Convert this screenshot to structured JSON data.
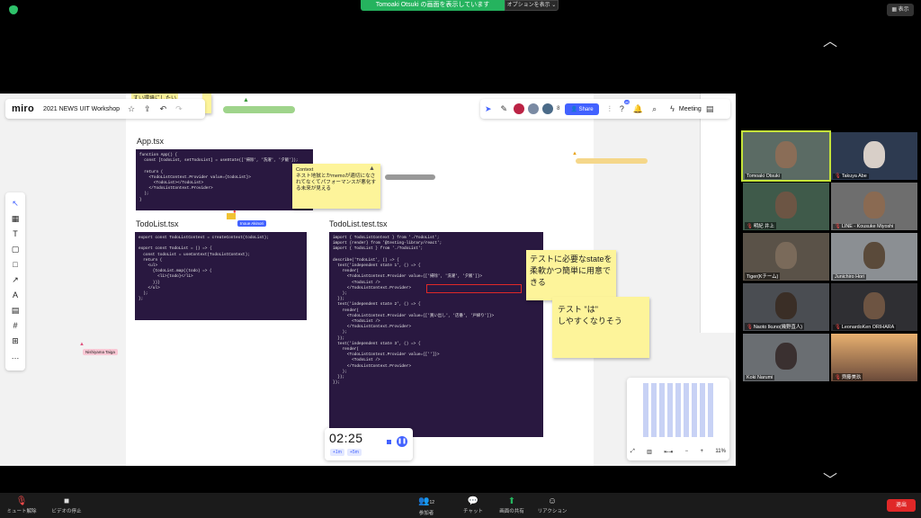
{
  "zoom_top": {
    "share_banner": "Tomoaki Otsuki の画面を表示しています",
    "options": "オプションを表示 ⌄",
    "view_button": "表示"
  },
  "miro": {
    "logo": "miro",
    "board_name": "2021 NEWS UIT Workshop",
    "avatar_count": "8",
    "share_label": "Share",
    "meeting_label": "Meeting",
    "notif_badge": "40",
    "top_sticky_text": "すい環境にしたい",
    "left_tools": [
      "↖",
      "▦",
      "T",
      "▢",
      "□",
      "↗",
      "A",
      "▤",
      "#",
      "⊞",
      "…"
    ],
    "frames": {
      "app_title": "App.tsx",
      "todolist_title": "TodoList.tsx",
      "test_title": "TodoList.test.tsx"
    },
    "code_app": "function App() {\n  const [todoList, setTodoList] = useState(['掃除', '洗濯', '夕飯']);\n\n  return (\n    <TodoListContext.Provider value={todoList}>\n      <TodoList></TodoList>\n    </TodoListContext.Provider>\n  );\n}",
    "code_todolist": "export const TodoListContext = createContext(todoList);\n\nexport const TodoList = () => {\n  const todoList = useContext(TodoListContext);\n  return (\n    <ul>\n      {todoList.map((todo) => (\n        <li>{todo}</li>\n      ))}\n    </ul>\n  );\n};",
    "code_test": "import { TodoListContext } from './TodoList';\nimport {render} from '@testing-library/react';\nimport { TodoList } from './TodoList';\n\ndescribe('TodoList', () => {\n  test('independent state 1', () => {\n    render(\n      <TodoListContext.Provider value={['掃除', '洗濯', '夕飯']}>\n        <TodoList />\n      </TodoListContext.Provider>\n    );\n  });\n  test('independent state 2', () => {\n    render(\n      <TodoListContext.Provider value={['買い出し', '店番', '戸締り']}>\n        <TodoList />\n      </TodoListContext.Provider>\n    );\n  });\n  test('independent state 3', () => {\n    render(\n      <TodoListContext.Provider value={['']}>\n        <TodoList />\n      </TodoListContext.Provider>\n    );\n  });\n});",
    "sticky_context": "Context\nネスト地獄とかmemoが適切になされてなくてパフォーマンスが悪化する未来が見える",
    "sticky_state": "テストに必要なstateを柔軟かつ簡単に用意できる",
    "sticky_wa": "テスト \"は\"\nしやすくなりそう",
    "cursor_inoue": "Inoue Akinori",
    "cursor_nishiyama": "Nishiyama Taiga",
    "timer": {
      "digits": "02:25",
      "plus1": "+1m",
      "plus5": "+5m"
    },
    "zoom_level": "11%"
  },
  "participants": [
    {
      "name": "Tomoaki Otsuki",
      "muted": false,
      "active": true
    },
    {
      "name": "Takuya Abe",
      "muted": true
    },
    {
      "name": "明紀 井上",
      "muted": true
    },
    {
      "name": "LINE - Kousuke Miyoshi",
      "muted": true
    },
    {
      "name": "Tiger(Kチーム)",
      "muted": false
    },
    {
      "name": "Junichiro Hori",
      "muted": false
    },
    {
      "name": "Naoto Ikuno(幾野直人)",
      "muted": true
    },
    {
      "name": "LeonardoKen ORIHARA",
      "muted": true
    },
    {
      "name": "Koki Narumi",
      "muted": false
    },
    {
      "name": "齊藤美玖",
      "muted": true
    }
  ],
  "bottom_bar": {
    "unmute": "ミュート解除",
    "stop_video": "ビデオの停止",
    "participants": "参加者",
    "participants_count": "12",
    "chat": "チャット",
    "share_screen": "画面の共有",
    "reaction": "リアクション",
    "end": "退出"
  },
  "colors": {
    "zoom_green": "#25b35e",
    "miro_blue": "#4262ff",
    "end_red": "#e02828",
    "sticky_yellow": "#fdf49a"
  }
}
